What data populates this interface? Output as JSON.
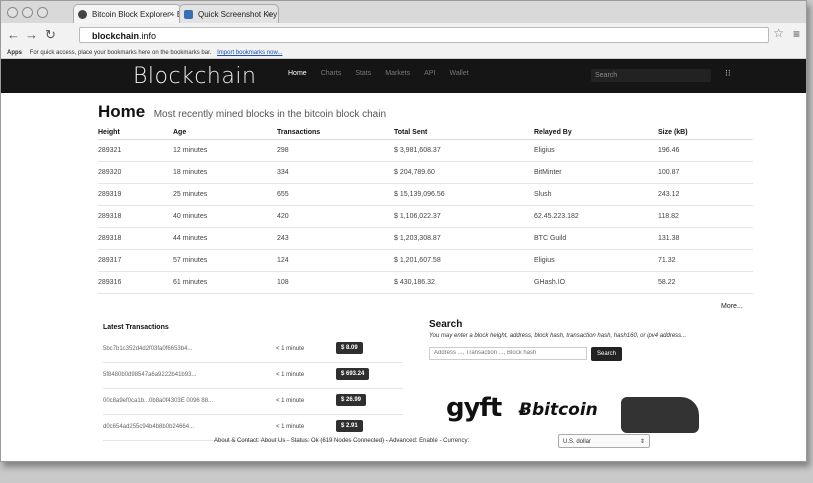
{
  "browser": {
    "tabs": [
      {
        "label": "Bitcoin Block Explorer - B"
      },
      {
        "label": "Quick Screenshot Key Co"
      }
    ],
    "url_host": "blockchain",
    "url_rest": ".info",
    "bookmarks_apps": "Apps",
    "bookmarks_text": "For quick access, place your bookmarks here on the bookmarks bar.",
    "bookmarks_link": "Import bookmarks now..."
  },
  "site": {
    "logo": "Blockchain",
    "nav": [
      "Home",
      "Charts",
      "Stats",
      "Markets",
      "API",
      "Wallet"
    ],
    "search_placeholder": "Search"
  },
  "main": {
    "title": "Home",
    "subtitle": "Most recently mined blocks in the bitcoin block chain",
    "columns": [
      "Height",
      "Age",
      "Transactions",
      "Total Sent",
      "Relayed By",
      "Size (kB)"
    ],
    "rows": [
      [
        "289321",
        "12 minutes",
        "298",
        "$ 3,981,608.37",
        "Eligius",
        "196.46"
      ],
      [
        "289320",
        "18 minutes",
        "334",
        "$ 204,789.60",
        "BitMinter",
        "100.87"
      ],
      [
        "289319",
        "25 minutes",
        "655",
        "$ 15,139,096.56",
        "Slush",
        "243.12"
      ],
      [
        "289318",
        "40 minutes",
        "420",
        "$ 1,106,022.37",
        "62.45.223.182",
        "118.82"
      ],
      [
        "289318",
        "44 minutes",
        "243",
        "$ 1,203,308.87",
        "BTC Guild",
        "131.38"
      ],
      [
        "289317",
        "57 minutes",
        "124",
        "$ 1,201,607.58",
        "Eligius",
        "71.32"
      ],
      [
        "289316",
        "61 minutes",
        "108",
        "$ 430,186.32",
        "GHash.IO",
        "58.22"
      ]
    ],
    "more": "More...",
    "latest_title": "Latest Transactions",
    "transactions": [
      {
        "hash": "5bc7b1c352d4d2f03fa0f6653b4...",
        "time": "< 1 minute",
        "amount": "$ 8.09"
      },
      {
        "hash": "5f8480b0d98547a6a9222b41b93...",
        "time": "< 1 minute",
        "amount": "$ 693.24"
      },
      {
        "hash": "00c8a9ef0ca1b...0b8a0f4303E 0096 88...",
        "time": "< 1 minute",
        "amount": "$ 26.99"
      },
      {
        "hash": "d0c654ad255c94b4b8b0b24664...",
        "time": "< 1 minute",
        "amount": "$ 2.91"
      }
    ],
    "search": {
      "title": "Search",
      "desc": "You may enter a block height, address, block hash, transaction hash, hash160, or ipv4 address...",
      "placeholder": "Address ..., Transaction ..., Block hash",
      "button": "Search"
    },
    "ad": {
      "gyft": "gyft",
      "bitcoin": "bitcoin"
    }
  },
  "footer": {
    "text": "About & Contact: About Us - Status: Ok (619 Nodes Connected) - Advanced: Enable - Currency:",
    "currency": "U.S. dollar"
  }
}
